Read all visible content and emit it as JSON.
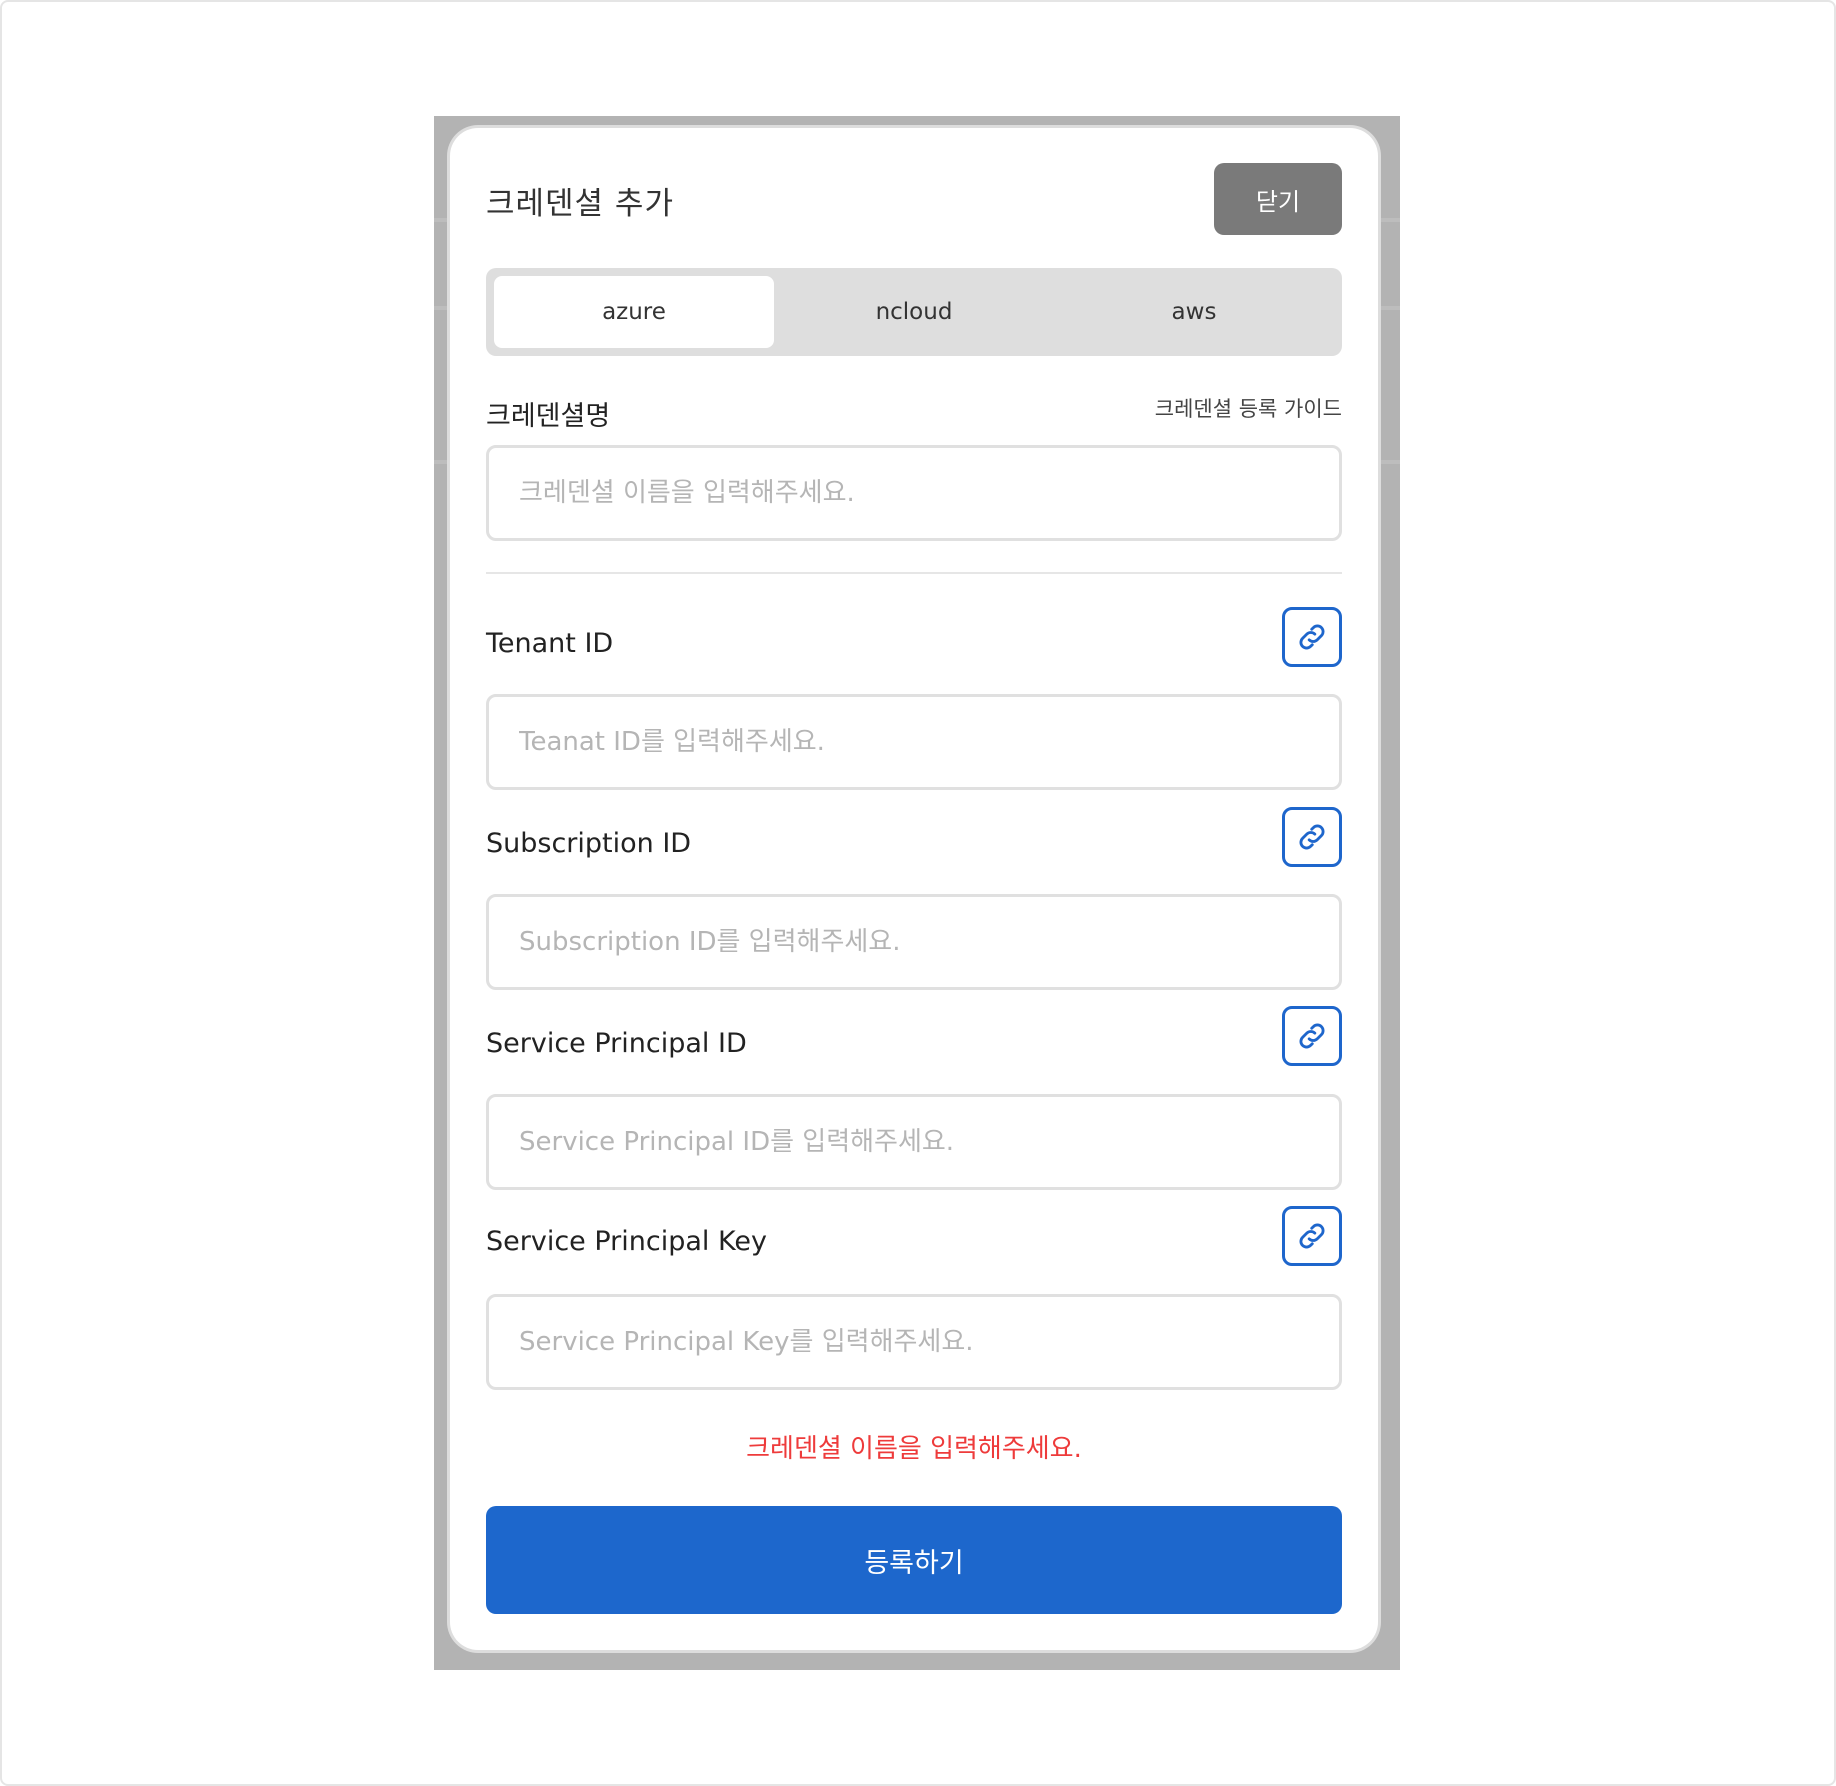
{
  "modal": {
    "title": "크레덴셜 추가",
    "close_label": "닫기"
  },
  "tabs": [
    {
      "label": "azure",
      "active": true
    },
    {
      "label": "ncloud",
      "active": false
    },
    {
      "label": "aws",
      "active": false
    }
  ],
  "credential_name": {
    "label": "크레덴셜명",
    "guide_link": "크레덴셜 등록 가이드",
    "placeholder": "크레덴셜 이름을 입력해주세요.",
    "value": ""
  },
  "fields": [
    {
      "label": "Tenant ID",
      "placeholder": "Teanat ID를 입력해주세요.",
      "value": "",
      "icon": "link-icon"
    },
    {
      "label": "Subscription ID",
      "placeholder": "Subscription ID를 입력해주세요.",
      "value": "",
      "icon": "link-icon"
    },
    {
      "label": "Service Principal ID",
      "placeholder": "Service Principal ID를 입력해주세요.",
      "value": "",
      "icon": "link-icon"
    },
    {
      "label": "Service Principal Key",
      "placeholder": "Service Principal Key를 입력해주세요.",
      "value": "",
      "icon": "link-icon"
    }
  ],
  "error_message": "크레덴셜 이름을 입력해주세요.",
  "submit_label": "등록하기",
  "colors": {
    "accent": "#1d67cc",
    "error": "#ee3b3b",
    "close_button": "#7a7a7a",
    "tab_bar": "#dedede"
  }
}
